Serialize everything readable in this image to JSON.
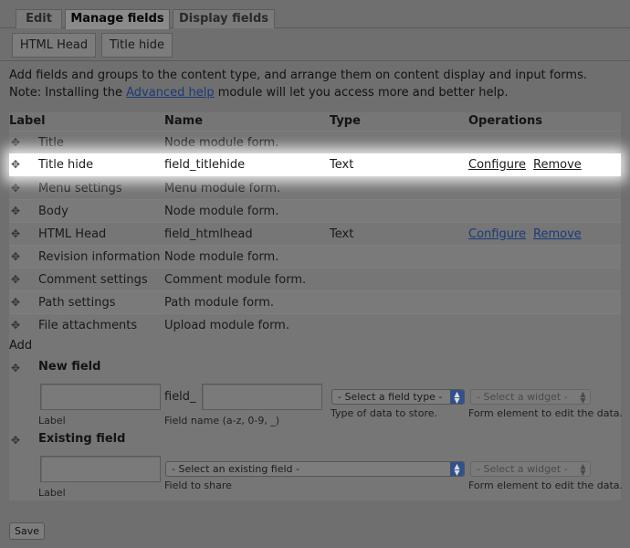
{
  "tabs": [
    {
      "label": "Edit",
      "active": false
    },
    {
      "label": "Manage fields",
      "active": true
    },
    {
      "label": "Display fields",
      "active": false
    }
  ],
  "subtabs": [
    "HTML Head",
    "Title hide"
  ],
  "help": {
    "line1": "Add fields and groups to the content type, and arrange them on content display and input forms.",
    "line2_before": "Note: Installing the ",
    "line2_link": "Advanced help",
    "line2_after": " module will let you access more and better help."
  },
  "table": {
    "headers": {
      "label": "Label",
      "name": "Name",
      "type": "Type",
      "operations": "Operations"
    },
    "rows": [
      {
        "label": "Title",
        "name": "Node module form.",
        "type": "",
        "configure": "",
        "remove": "",
        "highlighted": false
      },
      {
        "label": "Title hide",
        "name": "field_titlehide",
        "type": "Text",
        "configure": "Configure",
        "remove": "Remove",
        "highlighted": true
      },
      {
        "label": "Menu settings",
        "name": "Menu module form.",
        "type": "",
        "configure": "",
        "remove": "",
        "highlighted": false
      },
      {
        "label": "Body",
        "name": "Node module form.",
        "type": "",
        "configure": "",
        "remove": "",
        "highlighted": false
      },
      {
        "label": "HTML Head",
        "name": "field_htmlhead",
        "type": "Text",
        "configure": "Configure",
        "remove": "Remove",
        "highlighted": false
      },
      {
        "label": "Revision information",
        "name": "Node module form.",
        "type": "",
        "configure": "",
        "remove": "",
        "highlighted": false
      },
      {
        "label": "Comment settings",
        "name": "Comment module form.",
        "type": "",
        "configure": "",
        "remove": "",
        "highlighted": false
      },
      {
        "label": "Path settings",
        "name": "Path module form.",
        "type": "",
        "configure": "",
        "remove": "",
        "highlighted": false
      },
      {
        "label": "File attachments",
        "name": "Upload module form.",
        "type": "",
        "configure": "",
        "remove": "",
        "highlighted": false
      }
    ]
  },
  "add": {
    "heading": "Add",
    "new_field": {
      "title": "New field",
      "label_caption": "Label",
      "name_prefix": "field_",
      "name_caption": "Field name (a-z, 0-9, _)",
      "type_select": "- Select a field type -",
      "type_caption": "Type of data to store.",
      "widget_select": "- Select a widget -",
      "widget_caption": "Form element to edit the data."
    },
    "existing_field": {
      "title": "Existing field",
      "label_caption": "Label",
      "field_select": "- Select an existing field -",
      "field_caption": "Field to share",
      "widget_select": "- Select a widget -",
      "widget_caption": "Form element to edit the data."
    }
  },
  "save_label": "Save",
  "icons": {
    "drag": "drag-handle-icon",
    "select_arrow": "select-arrow-icon"
  }
}
